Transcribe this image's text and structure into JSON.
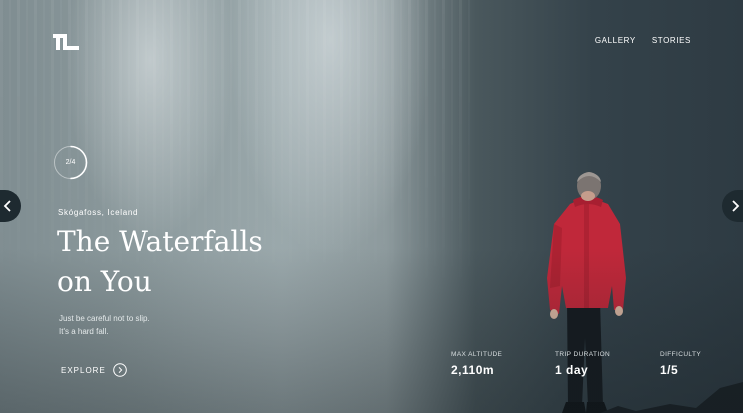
{
  "brand": {
    "logo_icon": "tl-logo-icon"
  },
  "nav": {
    "items": [
      {
        "label": "GALLERY"
      },
      {
        "label": "STORIES"
      }
    ]
  },
  "slider": {
    "counter": "2/4",
    "progress": 0.5,
    "prev_icon": "chevron-left-icon",
    "next_icon": "chevron-right-icon"
  },
  "hero": {
    "location": "Skógafoss, Iceland",
    "title_lines": [
      "The Waterfalls",
      "on You"
    ],
    "description_lines": [
      "Just be careful not to slip.",
      "It's a hard fall."
    ],
    "cta_label": "EXPLORE",
    "cta_icon": "chevron-right-circle-icon"
  },
  "stats": [
    {
      "label": "MAX ALTITUDE",
      "value": "2,110m"
    },
    {
      "label": "TRIP DURATION",
      "value": "1 day"
    },
    {
      "label": "DIFFICULTY",
      "value": "1/5"
    }
  ],
  "colors": {
    "text": "#ffffff",
    "jacket_red": "#c0283a",
    "arrow_bg": "#1e2a30"
  }
}
